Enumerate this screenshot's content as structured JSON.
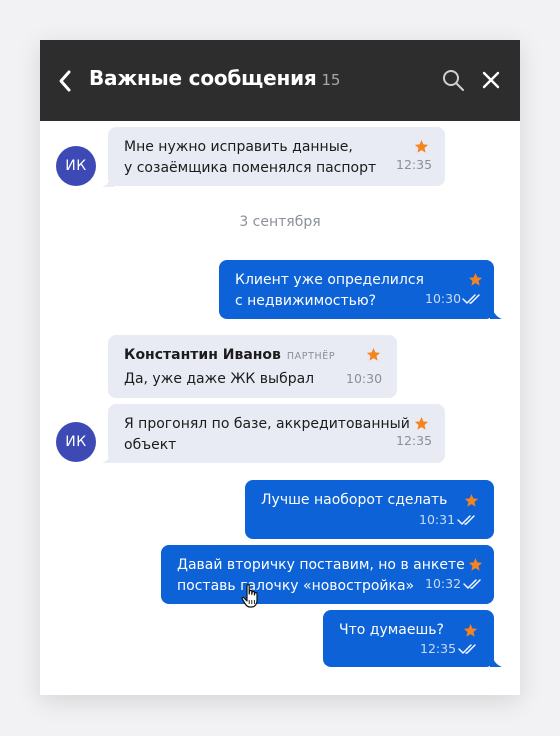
{
  "header": {
    "title": "Важные сообщения",
    "count": "15"
  },
  "date_separator": "3 сентября",
  "avatars": {
    "initials": "ИК"
  },
  "messages": [
    {
      "lines": [
        "Мне нужно исправить данные,",
        "у созаёмщика поменялся паспорт"
      ],
      "time": "12:35",
      "direction": "in"
    },
    {
      "lines": [
        "Клиент уже определился",
        "с недвижимостью?"
      ],
      "time": "10:30",
      "direction": "out"
    },
    {
      "sender": "Константин Иванов",
      "role": "ПАРТНЁР",
      "lines": [
        "Да, уже даже ЖК выбрал"
      ],
      "time": "10:30",
      "direction": "in"
    },
    {
      "lines": [
        "Я прогонял по базе, аккредитованный",
        "объект"
      ],
      "time": "12:35",
      "direction": "in"
    },
    {
      "lines": [
        "Лучше наоборот сделать"
      ],
      "time": "10:31",
      "direction": "out"
    },
    {
      "lines": [
        "Давай вторичку поставим, но в анкете",
        "поставь галочку «новостройка»"
      ],
      "time": "10:32",
      "direction": "out"
    },
    {
      "lines": [
        "Что думаешь?"
      ],
      "time": "12:35",
      "direction": "out"
    }
  ],
  "colors": {
    "header_bg": "#2d2d2d",
    "incoming_bubble": "#e8ebf3",
    "outgoing_bubble": "#0c62d6",
    "avatar_bg": "#3d4ab5",
    "star": "#f5841f"
  }
}
